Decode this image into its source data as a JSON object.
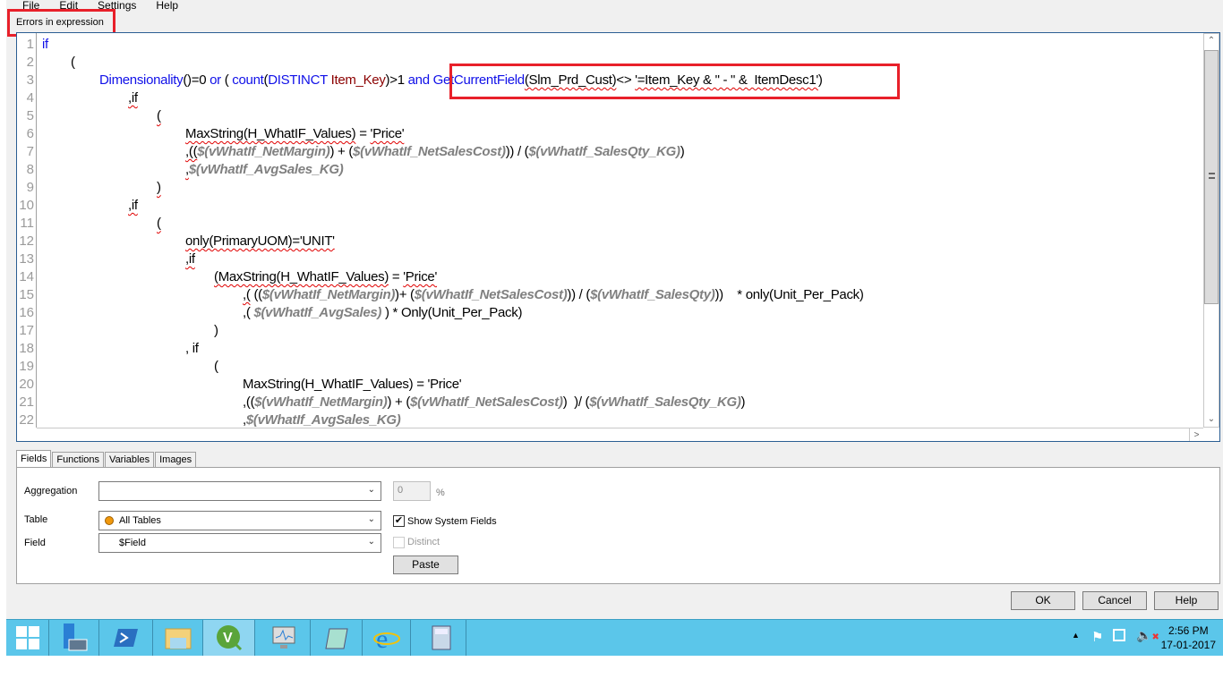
{
  "menu": [
    "File",
    "Edit",
    "Settings",
    "Help"
  ],
  "error_label": "Errors in expression",
  "code": [
    {
      "lvl": 0,
      "seg": [
        [
          "kw",
          "if"
        ]
      ]
    },
    {
      "lvl": 1,
      "seg": [
        [
          "",
          "("
        ]
      ]
    },
    {
      "lvl": 2,
      "seg": [
        [
          "kw",
          "Dimensionality"
        ],
        [
          "",
          "()=0 "
        ],
        [
          "kw",
          "or"
        ],
        [
          "",
          " ( "
        ],
        [
          "kw",
          "count"
        ],
        [
          "",
          "("
        ],
        [
          "kw",
          "DISTINCT"
        ],
        [
          "",
          " "
        ],
        [
          "fd",
          "Item_Key"
        ],
        [
          "",
          ")>1 "
        ],
        [
          "kw",
          "and"
        ],
        [
          "",
          " "
        ],
        [
          "kw",
          "GetCurrentField"
        ],
        [
          "sq",
          "(Slm_Prd_Cust)"
        ],
        [
          "",
          "<> "
        ],
        [
          "sq",
          "'=Item_Key & \" - \" &  ItemDesc1'"
        ],
        [
          "",
          ")"
        ]
      ]
    },
    {
      "lvl": 3,
      "seg": [
        [
          "sq",
          ",if"
        ]
      ]
    },
    {
      "lvl": 4,
      "seg": [
        [
          "sq",
          "("
        ]
      ]
    },
    {
      "lvl": 5,
      "seg": [
        [
          "sq",
          "MaxString(H_WhatIF_Values)"
        ],
        [
          "",
          " = "
        ],
        [
          "sq",
          "'Price'"
        ]
      ]
    },
    {
      "lvl": 5,
      "seg": [
        [
          "sq",
          ",(("
        ],
        [
          "vr",
          "$(vWhatIf_NetMargin)"
        ],
        [
          "",
          ") + ("
        ],
        [
          "vr",
          "$(vWhatIf_NetSalesCost)"
        ],
        [
          "",
          ")) / ("
        ],
        [
          "vr",
          "$(vWhatIf_SalesQty_KG)"
        ],
        [
          "",
          ")"
        ]
      ]
    },
    {
      "lvl": 5,
      "seg": [
        [
          "sq",
          ","
        ],
        [
          "vr",
          "$(vWhatIf_AvgSales_KG)"
        ]
      ]
    },
    {
      "lvl": 4,
      "seg": [
        [
          "sq",
          ")"
        ]
      ]
    },
    {
      "lvl": 3,
      "seg": [
        [
          "sq",
          ",if"
        ]
      ]
    },
    {
      "lvl": 4,
      "seg": [
        [
          "sq",
          "("
        ]
      ]
    },
    {
      "lvl": 5,
      "seg": [
        [
          "sq",
          "only(PrimaryUOM)='UNIT'"
        ]
      ]
    },
    {
      "lvl": 5,
      "seg": [
        [
          "sq",
          ",if"
        ]
      ]
    },
    {
      "lvl": 6,
      "seg": [
        [
          "sq",
          "(MaxString(H_WhatIF_Values)"
        ],
        [
          "",
          " = "
        ],
        [
          "sq",
          "'Price'"
        ]
      ]
    },
    {
      "lvl": 7,
      "seg": [
        [
          "sq",
          ",("
        ],
        [
          "",
          " (("
        ],
        [
          "vr",
          "$(vWhatIf_NetMargin)"
        ],
        [
          "",
          ")+ ("
        ],
        [
          "vr",
          "$(vWhatIf_NetSalesCost)"
        ],
        [
          "",
          ")) / ("
        ],
        [
          "vr",
          "$(vWhatIf_SalesQty)"
        ],
        [
          "",
          "))    * only(Unit_Per_Pack)"
        ]
      ]
    },
    {
      "lvl": 7,
      "seg": [
        [
          "",
          ",( "
        ],
        [
          "vr",
          "$(vWhatIf_AvgSales)"
        ],
        [
          "",
          " ) * Only(Unit_Per_Pack)"
        ]
      ]
    },
    {
      "lvl": 6,
      "seg": [
        [
          "",
          ")"
        ]
      ]
    },
    {
      "lvl": 5,
      "seg": [
        [
          "",
          ", if"
        ]
      ]
    },
    {
      "lvl": 6,
      "seg": [
        [
          "",
          "("
        ]
      ]
    },
    {
      "lvl": 7,
      "seg": [
        [
          "",
          "MaxString(H_WhatIF_Values) = 'Price'"
        ]
      ]
    },
    {
      "lvl": 7,
      "seg": [
        [
          "",
          ",(("
        ],
        [
          "vr",
          "$(vWhatIf_NetMargin)"
        ],
        [
          "",
          ") + ("
        ],
        [
          "vr",
          "$(vWhatIf_NetSalesCost)"
        ],
        [
          "",
          ")  )/ ("
        ],
        [
          "vr",
          "$(vWhatIf_SalesQty_KG)"
        ],
        [
          "",
          ")"
        ]
      ]
    },
    {
      "lvl": 7,
      "seg": [
        [
          "",
          ","
        ],
        [
          "vr",
          "$(vWhatIf_AvgSales_KG)"
        ]
      ]
    }
  ],
  "tabs": [
    "Fields",
    "Functions",
    "Variables",
    "Images"
  ],
  "fields": {
    "aggregation_label": "Aggregation",
    "aggregation_value": "",
    "percent_value": "0",
    "percent_sign": "%",
    "table_label": "Table",
    "table_value": "All Tables",
    "field_label": "Field",
    "field_value": "$Field",
    "show_system_fields": "Show System Fields",
    "show_system_checked": true,
    "distinct": "Distinct",
    "paste": "Paste"
  },
  "buttons": {
    "ok": "OK",
    "cancel": "Cancel",
    "help": "Help"
  },
  "clock": {
    "time": "2:56 PM",
    "date": "17-01-2017"
  },
  "taskbar": [
    "start",
    "server-manager",
    "powershell",
    "file-explorer",
    "qlikview",
    "performance-monitor",
    "notepad",
    "internet-explorer",
    "calculator"
  ]
}
